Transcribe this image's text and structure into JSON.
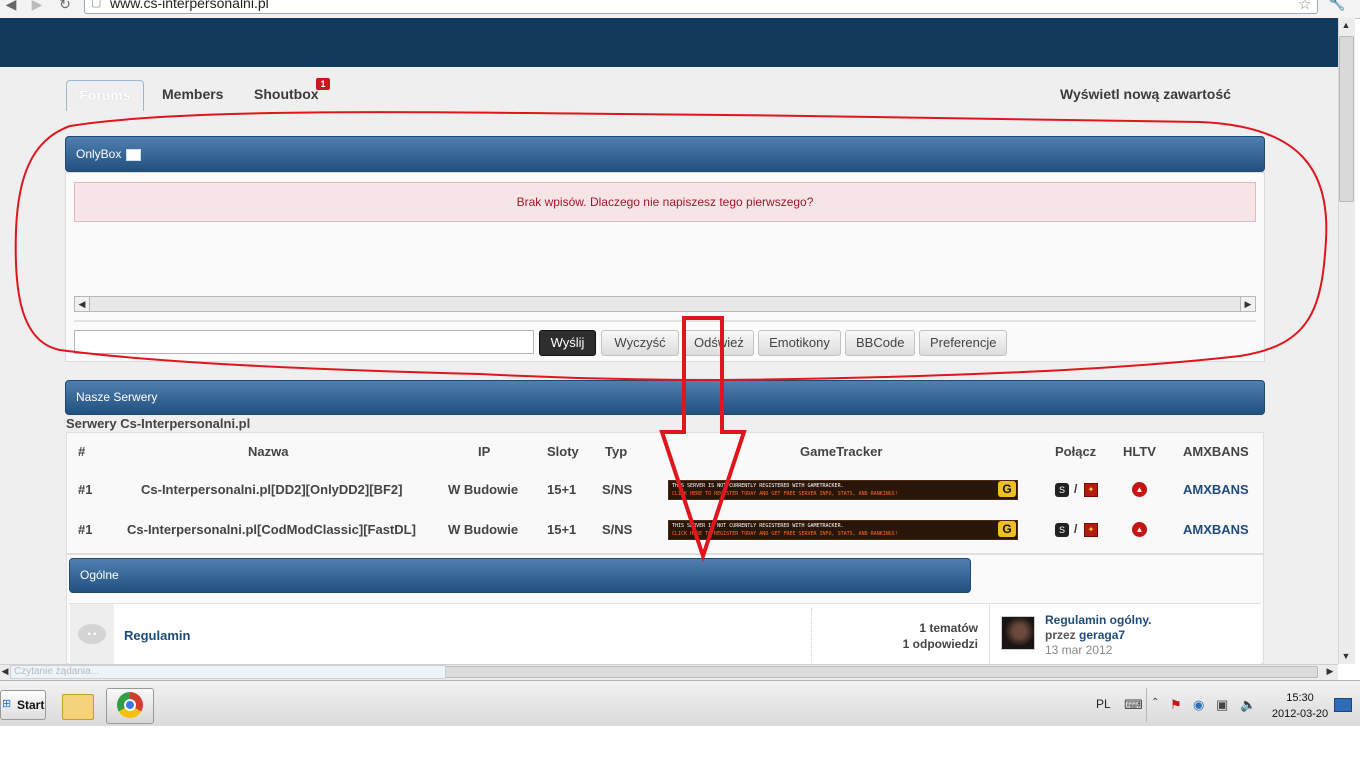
{
  "browser": {
    "url": "www.cs-interpersonalni.pl"
  },
  "nav": {
    "tabs": [
      {
        "label": "Forums"
      },
      {
        "label": "Members"
      },
      {
        "label": "Shoutbox",
        "badge": "1"
      }
    ],
    "new_content": "Wyświetl nową zawartość"
  },
  "onlybox": {
    "title": "OnlyBox",
    "empty_message": "Brak wpisów. Dlaczego nie napiszesz tego pierwszego?",
    "input_value": "",
    "buttons": [
      "Wyślij",
      "Wyczyść",
      "Odśwież",
      "Emotikony",
      "BBCode",
      "Preferencje"
    ]
  },
  "servers": {
    "bar_title": "Nasze Serwery",
    "section_title": "Serwery Cs-Interpersonalni.pl",
    "columns": [
      "#",
      "Nazwa",
      "IP",
      "Sloty",
      "Typ",
      "GameTracker",
      "Połącz",
      "HLTV",
      "AMXBANS"
    ],
    "rows": [
      {
        "num": "#1",
        "name": "Cs-Interpersonalni.pl[DD2][OnlyDD2][BF2]",
        "ip": "W Budowie",
        "slots": "15+1",
        "type": "S/NS",
        "amxbans": "AMXBANS"
      },
      {
        "num": "#1",
        "name": "Cs-Interpersonalni.pl[CodModClassic][FastDL]",
        "ip": "W Budowie",
        "slots": "15+1",
        "type": "S/NS",
        "amxbans": "AMXBANS"
      }
    ],
    "gametracker_banner": {
      "line1": "THIS SERVER IS NOT CURRENTLY REGISTERED WITH GAMETRACKER.",
      "line2": "CLICK HERE TO REGISTER TODAY AND GET FREE SERVER INFO, STATS, AND RANKINGS!"
    },
    "connect_separator": "/"
  },
  "category": {
    "title": "Ogólne",
    "forum": {
      "name": "Regulamin",
      "topics": "1 tematów",
      "replies": "1 odpowiedzi",
      "last_post_title": "Regulamin ogólny.",
      "last_post_by_prefix": "przez",
      "last_post_author": "geraga7",
      "last_post_date": "13 mar 2012"
    }
  },
  "status_bar": {
    "text": "Czytanie żądania..."
  },
  "taskbar": {
    "start_label": "Start",
    "language": "PL",
    "time": "15:30",
    "date": "2012-03-20"
  },
  "icons": [
    "back-icon",
    "forward-icon",
    "reload-icon",
    "page-icon",
    "star-icon",
    "wrench-icon",
    "windows-logo-icon",
    "folder-icon",
    "chrome-icon",
    "steam-icon",
    "hlsw-icon",
    "hltv-icon",
    "gametracker-logo-icon",
    "speech-bubble-icon",
    "keyboard-icon",
    "flag-icon",
    "network-icon",
    "volume-icon"
  ],
  "colors": {
    "header": "#113a5c",
    "panel_bar": "#2f5f90",
    "link": "#1f4b7a",
    "error_text": "#9c1b27",
    "annotation_red": "#e0161e"
  }
}
